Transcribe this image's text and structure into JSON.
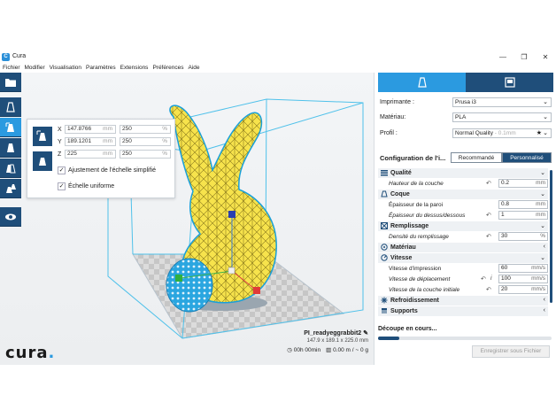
{
  "window": {
    "title": "Cura",
    "app_icon": "C",
    "controls": [
      "—",
      "❐",
      "✕"
    ]
  },
  "menu": [
    "Fichier",
    "Modifier",
    "Visualisation",
    "Paramètres",
    "Extensions",
    "Préférences",
    "Aide"
  ],
  "scale_panel": {
    "x": {
      "label": "X",
      "mm": "147.8766",
      "mm_unit": "mm",
      "pct": "250",
      "pct_unit": "%"
    },
    "y": {
      "label": "Y",
      "mm": "189.1201",
      "mm_unit": "mm",
      "pct": "250",
      "pct_unit": "%"
    },
    "z": {
      "label": "Z",
      "mm": "225",
      "mm_unit": "mm",
      "pct": "250",
      "pct_unit": "%"
    },
    "snap_scaling": "Ajustement de l'échelle simplifié",
    "uniform_scaling": "Échelle uniforme",
    "snap_checked": true,
    "uniform_checked": true
  },
  "logo": {
    "text": "cura",
    "dot": "."
  },
  "job": {
    "name": "PI_readyeggrabbit2",
    "dims": "147.9 x 189.1 x 225.0 mm",
    "time": "00h 00min",
    "material": "0.00 m / ~ 0 g"
  },
  "print_setup": {
    "printer_label": "Imprimante :",
    "printer_value": "Prusa i3",
    "material_label": "Matériau:",
    "material_value": "PLA",
    "profile_label": "Profil :",
    "profile_value": "Normal Quality",
    "profile_suffix": " - 0.1mm",
    "config_title": "Configuration de l'i...",
    "recommended": "Recommandé",
    "custom": "Personnalisé"
  },
  "settings": {
    "quality": {
      "name": "Qualité",
      "layer_height": {
        "label": "Hauteur de la couche",
        "value": "0.2",
        "unit": "mm"
      }
    },
    "shell": {
      "name": "Coque",
      "wall": {
        "label": "Épaisseur de la paroi",
        "value": "0.8",
        "unit": "mm"
      },
      "top_bottom": {
        "label": "Épaisseur du dessus/dessous",
        "value": "1",
        "unit": "mm"
      }
    },
    "infill": {
      "name": "Remplissage",
      "density": {
        "label": "Densité du remplissage",
        "value": "30",
        "unit": "%"
      }
    },
    "material": {
      "name": "Matériau"
    },
    "speed": {
      "name": "Vitesse",
      "print_speed": {
        "label": "Vitesse d'impression",
        "value": "60",
        "unit": "mm/s"
      },
      "travel_speed": {
        "label": "Vitesse de déplacement",
        "value": "100",
        "unit": "mm/s"
      },
      "initial_layer": {
        "label": "Vitesse de la couche initiale",
        "value": "20",
        "unit": "mm/s"
      }
    },
    "cooling": {
      "name": "Refroidissement"
    },
    "support": {
      "name": "Supports"
    }
  },
  "slicing": {
    "status": "Découpe en cours...",
    "progress": 0.12,
    "save_button": "Enregistrer sous Fichier"
  },
  "colors": {
    "accent": "#2b9ae0",
    "dark_blue": "#1f4e7a",
    "model_yellow": "#f5e04a",
    "model_outline": "#1aa0d8"
  }
}
